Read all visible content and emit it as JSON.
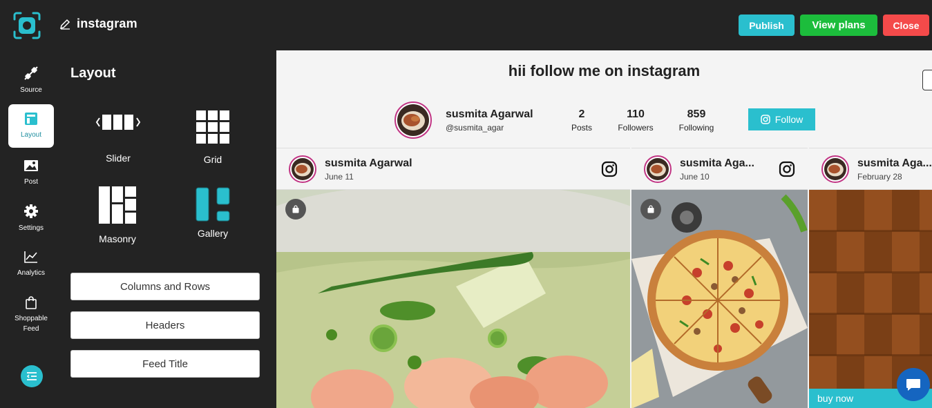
{
  "app": {
    "title": "instagram"
  },
  "header_buttons": {
    "publish": "Publish",
    "plans": "View plans",
    "close": "Close"
  },
  "colors": {
    "accent": "#2abfce",
    "green": "#1cbd3c",
    "red": "#f44a4a",
    "dark": "#232323",
    "chat": "#1565c0"
  },
  "iconbar": [
    {
      "label": "Source",
      "icon": "plug-icon"
    },
    {
      "label": "Layout",
      "icon": "layout-icon",
      "active": true
    },
    {
      "label": "Post",
      "icon": "image-icon"
    },
    {
      "label": "Settings",
      "icon": "gear-icon"
    },
    {
      "label": "Analytics",
      "icon": "chart-icon"
    },
    {
      "label": "Shoppable Feed",
      "icon": "shopping-bag-icon"
    }
  ],
  "panel": {
    "title": "Layout",
    "options": [
      "Slider",
      "Grid",
      "Masonry",
      "Gallery"
    ],
    "selected": "Gallery",
    "buttons": [
      "Columns and Rows",
      "Headers",
      "Feed Title"
    ]
  },
  "preview": {
    "feed_title": "hii follow me on instagram",
    "profile": {
      "name": "susmita Agarwal",
      "handle": "@susmita_agar",
      "stats": [
        {
          "num": "2",
          "label": "Posts"
        },
        {
          "num": "110",
          "label": "Followers"
        },
        {
          "num": "859",
          "label": "Following"
        }
      ],
      "follow": "Follow"
    },
    "posts": [
      {
        "name": "susmita Agarwal",
        "date": "June 11"
      },
      {
        "name": "susmita Aga...",
        "date": "June 10"
      },
      {
        "name": "susmita Aga...",
        "date": "February 28",
        "buy": "buy now"
      }
    ]
  }
}
